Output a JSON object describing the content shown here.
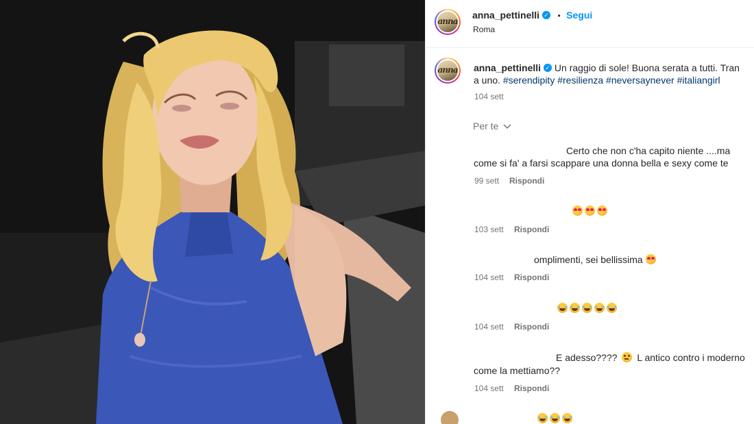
{
  "post": {
    "username": "anna_pettinelli",
    "follow_label": "Segui",
    "location": "Roma",
    "separator": "•",
    "avatar_text": "anna"
  },
  "caption": {
    "username": "anna_pettinelli",
    "text": "Un raggio di sole! Buona serata a tutti. Tran",
    "text_line2": "a uno.",
    "hashtags": [
      "#serendipity",
      "#resilienza",
      "#neversaynever",
      "#italiangirl"
    ],
    "time": "104 sett"
  },
  "sort": {
    "label": "Per te",
    "icon": "chevron-down-icon"
  },
  "comments": [
    {
      "line1": "Certo che non c'ha capito niente ....ma",
      "line2": "come si fa' a farsi scappare una donna bella e sexy come te",
      "time": "99 sett",
      "reply": "Rispondi"
    },
    {
      "emojis": [
        "heart-eyes-emoji",
        "heart-eyes-emoji",
        "heart-eyes-emoji"
      ],
      "time": "103 sett",
      "reply": "Rispondi"
    },
    {
      "line1": "omplimenti, sei bellissima",
      "emojis": [
        "heart-eyes-emoji"
      ],
      "time": "104 sett",
      "reply": "Rispondi"
    },
    {
      "emojis": [
        "tears-of-joy-emoji",
        "tears-of-joy-emoji",
        "tears-of-joy-emoji",
        "tears-of-joy-emoji",
        "tears-of-joy-emoji"
      ],
      "time": "104 sett",
      "reply": "Rispondi"
    },
    {
      "line1a": "E adesso????",
      "line1b": "L antico contro i moderno",
      "line2": "come la mettiamo??",
      "emojis": [
        "thinking-emoji"
      ],
      "time": "104 sett",
      "reply": "Rispondi"
    }
  ],
  "colors": {
    "accent": "#0095f6",
    "link": "#00376b",
    "muted": "#737373",
    "dress": "#3a55b4",
    "hair": "#e9c76a"
  }
}
